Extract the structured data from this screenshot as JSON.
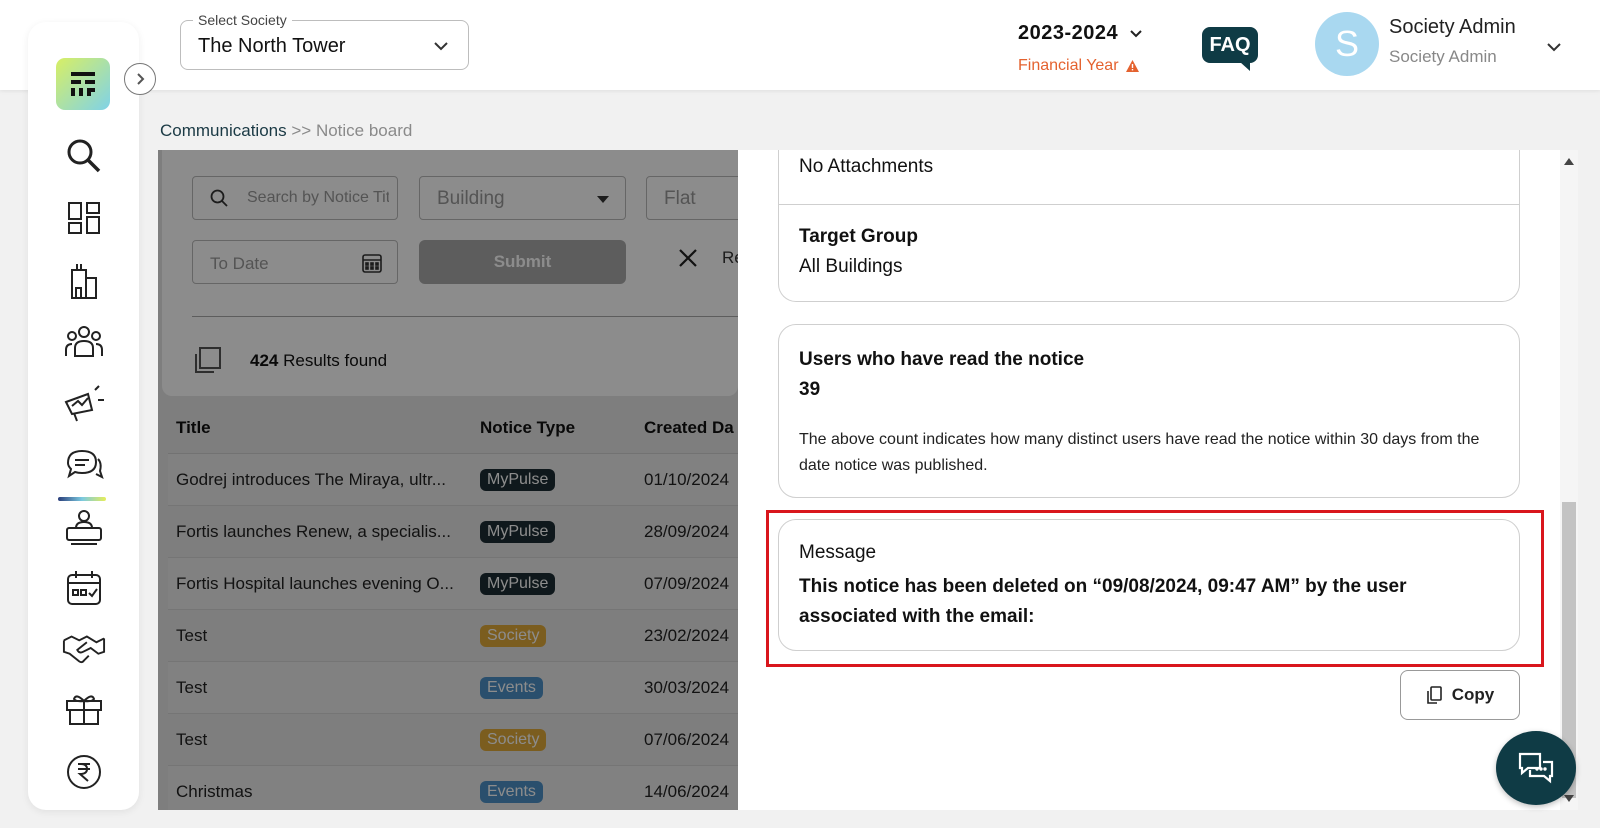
{
  "header": {
    "society_label": "Select Society",
    "society_value": "The North Tower",
    "financial_year": "2023-2024",
    "financial_year_label": "Financial Year",
    "faq": "FAQ",
    "avatar_letter": "S",
    "user_name": "Society Admin",
    "user_role": "Society Admin"
  },
  "sidebar": {
    "items": [
      "search-icon",
      "dashboard-icon",
      "building-icon",
      "members-icon",
      "announcement-icon",
      "communications-icon",
      "helpdesk-icon",
      "calendar-icon",
      "partnership-icon",
      "amenities-icon",
      "rupee-icon"
    ],
    "active": "communications-icon"
  },
  "breadcrumb": {
    "parent": "Communications",
    "separator": ">>",
    "current": "Notice board"
  },
  "filters": {
    "search_placeholder": "Search by Notice Title",
    "building_placeholder": "Building",
    "flat_placeholder": "Flat",
    "to_date_placeholder": "To Date",
    "submit": "Submit",
    "reset": "Re"
  },
  "results": {
    "count": "424",
    "label": "Results found"
  },
  "table": {
    "columns": [
      "Title",
      "Notice Type",
      "Created Da"
    ],
    "rows": [
      {
        "title": "Godrej introduces The Miraya, ultr...",
        "type": "MyPulse",
        "date": "01/10/2024"
      },
      {
        "title": "Fortis launches Renew, a specialis...",
        "type": "MyPulse",
        "date": "28/09/2024"
      },
      {
        "title": "Fortis Hospital launches evening O...",
        "type": "MyPulse",
        "date": "07/09/2024"
      },
      {
        "title": "Test",
        "type": "Society",
        "date": "23/02/2024"
      },
      {
        "title": "Test",
        "type": "Events",
        "date": "30/03/2024"
      },
      {
        "title": "Test",
        "type": "Society",
        "date": "07/06/2024"
      },
      {
        "title": "Christmas",
        "type": "Events",
        "date": "14/06/2024"
      }
    ],
    "badge_colors": {
      "MyPulse": "#1c2d33",
      "Society": "#e0a93a",
      "Events": "#4e90c6"
    }
  },
  "panel": {
    "attachments": "No Attachments",
    "target_group_label": "Target Group",
    "target_group_value": "All Buildings",
    "read_label": "Users who have read the notice",
    "read_count": "39",
    "read_note": "The above count indicates how many distinct users have read the notice within 30 days from the date notice was published.",
    "message_label": "Message",
    "message_text": "This notice has been deleted on “09/08/2024, 09:47 AM” by the user associated with the email:",
    "copy": "Copy"
  },
  "colors": {
    "brand_dark": "#0f3b45",
    "warning": "#e4622f",
    "highlight": "#d9161c"
  }
}
